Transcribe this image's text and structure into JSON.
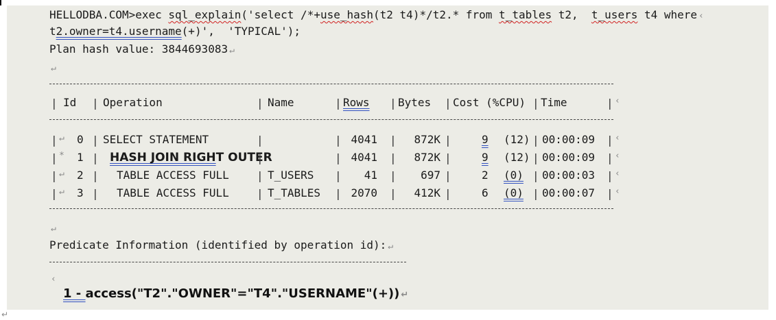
{
  "command": {
    "prompt": "HELLODBA.COM>exec ",
    "fn": "sql_explain",
    "arg_open": "('select /*+",
    "hint": "use_hash",
    "hint_args": "(t2 t4)*/t2.* from ",
    "tbl1": "t_tables",
    "mid": " t2,  ",
    "tbl2": "t_users",
    "tail": " t4 where",
    "line2_pre": "t",
    "line2_link": "2.owner=t4.username",
    "line2_post": "(+)',  'TYPICAL');"
  },
  "plan_hash": "Plan hash value: 3844693083",
  "table": {
    "headers": {
      "id": "Id",
      "operation": "Operation",
      "name": "Name",
      "rows": "Rows",
      "bytes": "Bytes",
      "cost": "Cost (%CPU)",
      "time": "Time"
    },
    "rows": [
      {
        "prefix": "",
        "id": "0",
        "operation": "SELECT STATEMENT",
        "name": "",
        "rows": "4041",
        "bytes": "872K",
        "cost": "9",
        "cpu": "(12)",
        "time": "00:00:09"
      },
      {
        "prefix": "*",
        "id": "1",
        "operation": "HASH JOIN RIGHT OUTER",
        "name": "",
        "rows": "4041",
        "bytes": "872K",
        "cost": "9",
        "cpu": "(12)",
        "time": "00:00:09"
      },
      {
        "prefix": "",
        "id": "2",
        "operation": "TABLE ACCESS FULL",
        "name": "T_USERS",
        "rows": "41",
        "bytes": "697",
        "cost": "2",
        "cpu": "(0)",
        "time": "00:00:03"
      },
      {
        "prefix": "",
        "id": "3",
        "operation": "TABLE ACCESS FULL",
        "name": "T_TABLES",
        "rows": "2070",
        "bytes": "412K",
        "cost": "6",
        "cpu": "(0)",
        "time": "00:00:07"
      }
    ]
  },
  "predicate": {
    "title": "Predicate Information (identified by operation id):",
    "id": "1",
    "sep": " - ",
    "text": "access(\"T2\".\"OWNER\"=\"T4\".\"USERNAME\"(+))"
  },
  "marks": {
    "para": "↵",
    "arrow": "‹"
  }
}
